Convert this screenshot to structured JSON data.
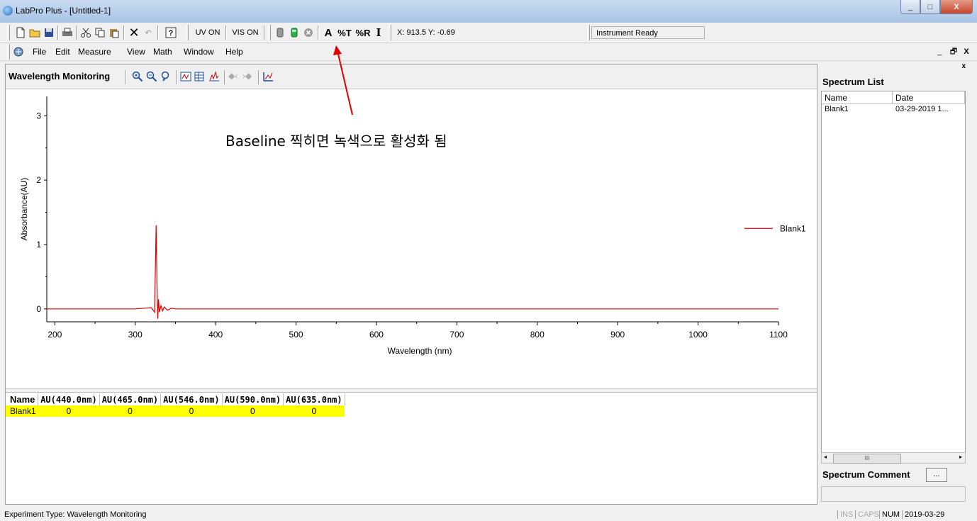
{
  "window": {
    "title": "LabPro Plus - [Untitled-1]",
    "min": "_",
    "max": "□",
    "close": "X"
  },
  "toolbar": {
    "uv_on": "UV ON",
    "vis_on": "VIS ON",
    "abs_mode": "A",
    "pct_t": "%T",
    "pct_r": "%R",
    "intensity": "I",
    "coords": "X: 913.5 Y: -0.69",
    "status": "Instrument Ready"
  },
  "menu": {
    "items": [
      "File",
      "Edit",
      "Measure",
      "View",
      "Math",
      "Window",
      "Help"
    ],
    "mdi_min": "_",
    "mdi_restore": "🗗",
    "mdi_close": "X"
  },
  "child": {
    "title": "Wavelength Monitoring"
  },
  "chart_data": {
    "type": "line",
    "xlabel": "Wavelength (nm)",
    "ylabel": "Absorbance(AU)",
    "xlim": [
      190,
      1100
    ],
    "ylim": [
      -0.2,
      3.3
    ],
    "x_ticks": [
      200,
      300,
      400,
      500,
      600,
      700,
      800,
      900,
      1000,
      1100
    ],
    "y_ticks": [
      0,
      1,
      2,
      3
    ],
    "legend_position": "right",
    "series": [
      {
        "name": "Blank1",
        "color": "#e00000",
        "x": [
          190,
          300,
          320,
          324,
          325,
          326,
          327,
          328,
          329,
          330,
          332,
          334,
          336,
          340,
          345,
          350,
          360,
          400,
          500,
          600,
          700,
          800,
          900,
          1000,
          1100
        ],
        "y": [
          0,
          0,
          0.02,
          -0.05,
          0.6,
          1.3,
          0.4,
          -0.15,
          0.15,
          -0.05,
          0.05,
          -0.03,
          0.03,
          -0.02,
          0.01,
          0,
          0,
          0,
          0,
          0,
          0,
          0,
          0,
          0,
          0
        ]
      }
    ]
  },
  "results": {
    "headers": [
      "Name",
      "AU(440.0nm)",
      "AU(465.0nm)",
      "AU(546.0nm)",
      "AU(590.0nm)",
      "AU(635.0nm)"
    ],
    "rows": [
      [
        "Blank1",
        "0",
        "0",
        "0",
        "0",
        "0"
      ]
    ]
  },
  "panel": {
    "close": "x",
    "title": "Spectrum List",
    "col_name": "Name",
    "col_date": "Date",
    "rows": [
      {
        "name": "Blank1",
        "date": "03-29-2019 1..."
      }
    ],
    "scroll_thumb": "III",
    "comment_label": "Spectrum Comment",
    "comment_button": "..."
  },
  "annotation": "Baseline 찍히면 녹색으로 활성화 됨",
  "statusbar": {
    "text": "Experiment Type: Wavelength Monitoring",
    "ins": "INS",
    "caps": "CAPS",
    "num": "NUM",
    "date": "2019-03-29"
  }
}
